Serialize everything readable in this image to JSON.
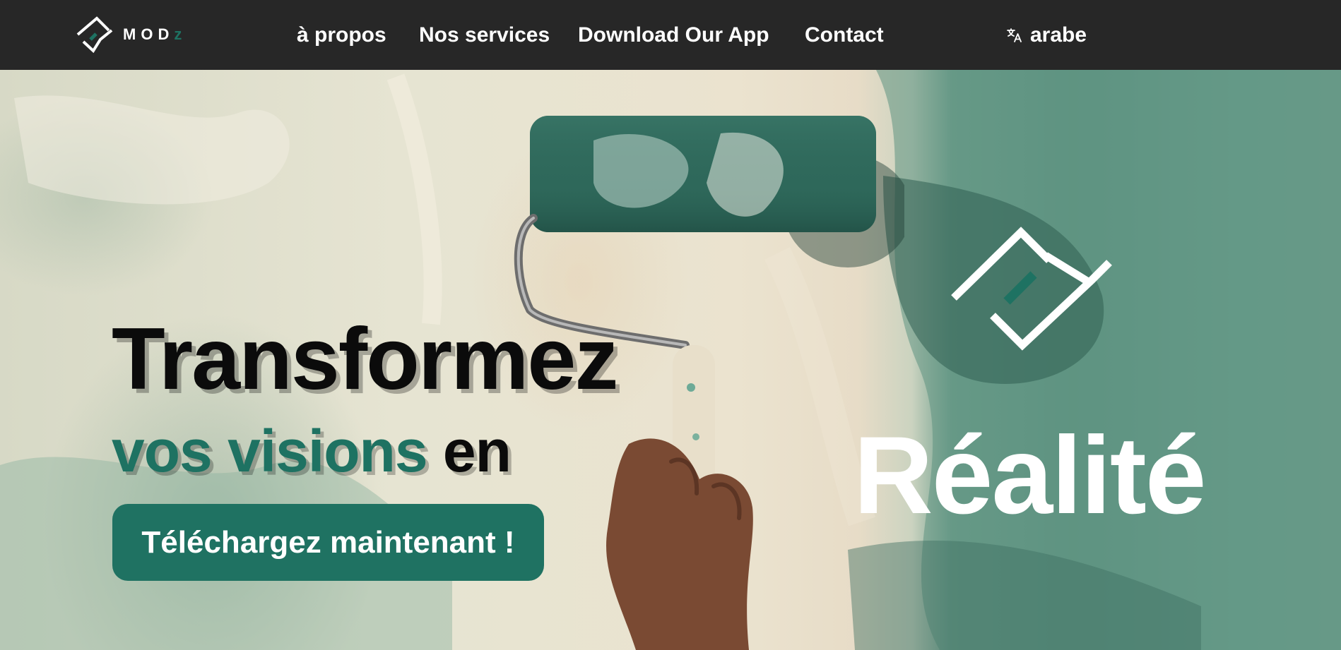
{
  "brand": {
    "name_main": "MOD",
    "name_accent": "z",
    "logo_icon": "modz-logo-icon",
    "accent_color": "#1e7262"
  },
  "nav": {
    "items": [
      {
        "label": "à propos"
      },
      {
        "label": "Nos services"
      },
      {
        "label": "Download Our App"
      },
      {
        "label": "Contact"
      }
    ],
    "language": {
      "icon": "translate-icon",
      "label": "arabe"
    }
  },
  "hero": {
    "headline_line1": "Transformez",
    "headline_line2_accent": "vos visions",
    "headline_line2_rest": "en",
    "cta_label": "Téléchargez maintenant !",
    "right_word": "Réalité",
    "background_image": "paint-roller-on-wall-photo",
    "mark_icon": "modz-logo-icon"
  },
  "colors": {
    "navbar_bg": "#272727",
    "accent": "#1e7262",
    "button_bg": "#1f7262",
    "text_light": "#ffffff",
    "text_dark": "#0b0b0b"
  }
}
